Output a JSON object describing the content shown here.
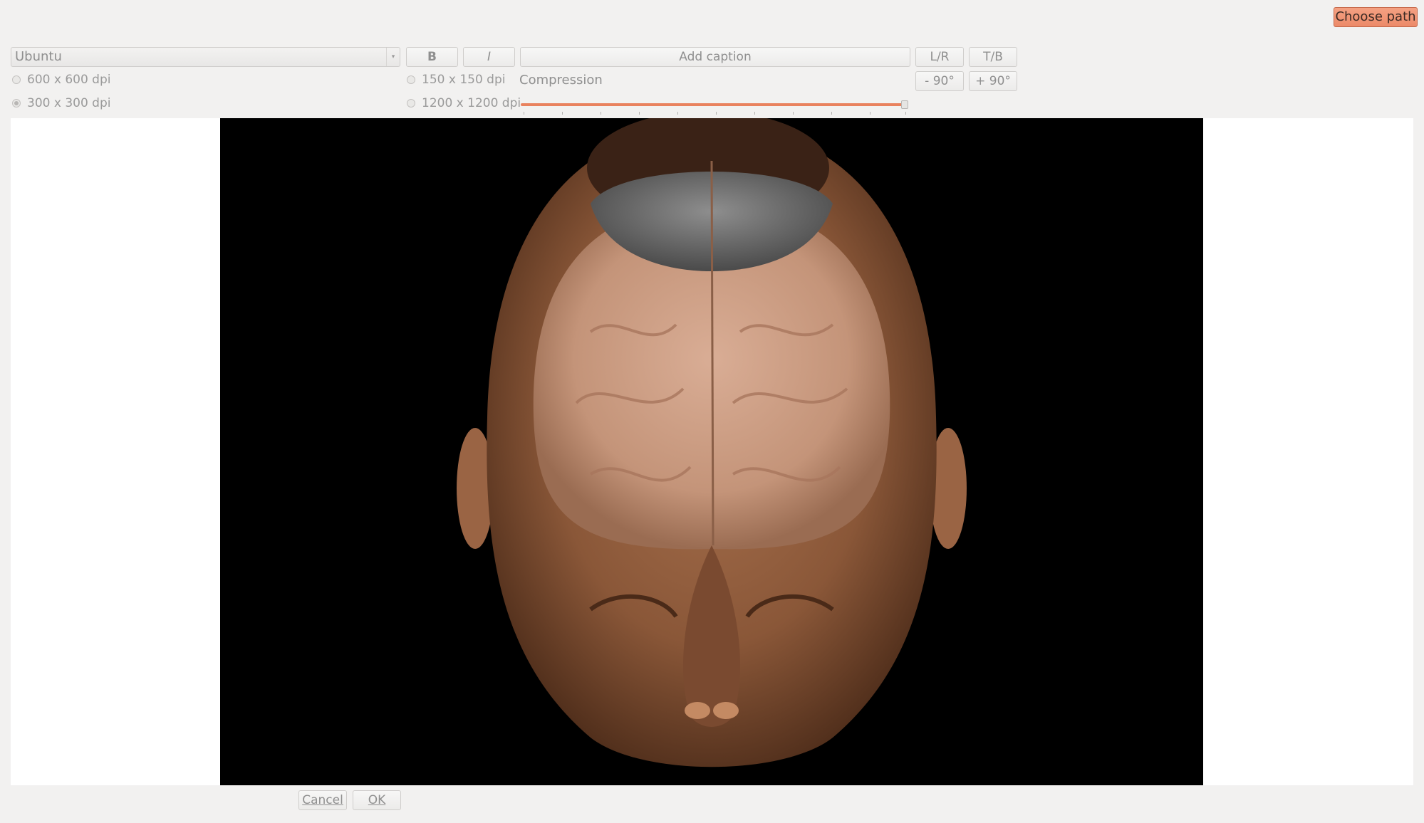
{
  "toolbar": {
    "choose_path": "Choose path",
    "font": "Ubuntu",
    "bold": "B",
    "italic": "I",
    "caption_placeholder": "Add caption",
    "flip_lr": "L/R",
    "flip_tb": "T/B",
    "rotate_left": "- 90°",
    "rotate_right": "+ 90°"
  },
  "resolution": {
    "options": [
      "600 x 600 dpi",
      "150 x 150 dpi",
      "300 x 300 dpi",
      "1200 x 1200 dpi"
    ],
    "selected": "300 x 300 dpi"
  },
  "compression": {
    "label": "Compression",
    "value_fraction": 1.0
  },
  "preview": {
    "content": "3D rendering of head with brain"
  },
  "dialog": {
    "cancel": "Cancel",
    "ok": "OK"
  },
  "colors": {
    "accent": "#e9825e",
    "button_highlight": "#ee8f6e",
    "background": "#f2f1f0",
    "preview_bg": "#000000"
  }
}
